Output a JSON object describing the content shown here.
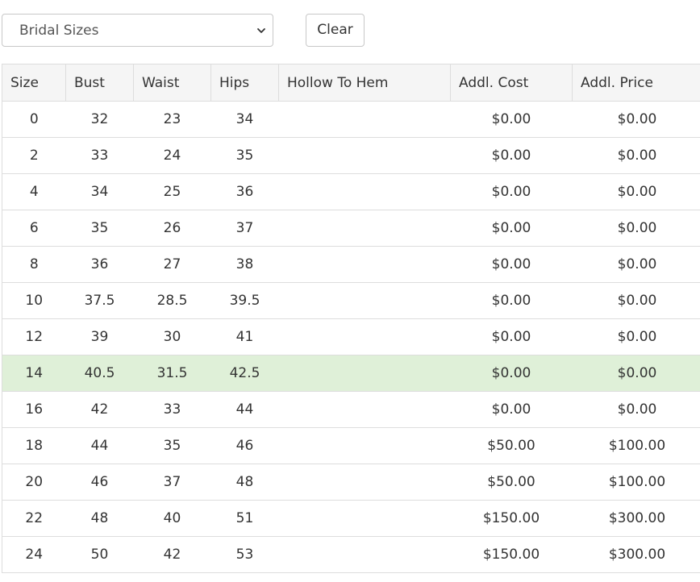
{
  "filter": {
    "selected": "Bridal Sizes",
    "clear_label": "Clear"
  },
  "table": {
    "headers": [
      "Size",
      "Bust",
      "Waist",
      "Hips",
      "Hollow To Hem",
      "Addl. Cost",
      "Addl. Price"
    ],
    "rows": [
      [
        "0",
        "32",
        "23",
        "34",
        "",
        "$0.00",
        "$0.00"
      ],
      [
        "2",
        "33",
        "24",
        "35",
        "",
        "$0.00",
        "$0.00"
      ],
      [
        "4",
        "34",
        "25",
        "36",
        "",
        "$0.00",
        "$0.00"
      ],
      [
        "6",
        "35",
        "26",
        "37",
        "",
        "$0.00",
        "$0.00"
      ],
      [
        "8",
        "36",
        "27",
        "38",
        "",
        "$0.00",
        "$0.00"
      ],
      [
        "10",
        "37.5",
        "28.5",
        "39.5",
        "",
        "$0.00",
        "$0.00"
      ],
      [
        "12",
        "39",
        "30",
        "41",
        "",
        "$0.00",
        "$0.00"
      ],
      [
        "14",
        "40.5",
        "31.5",
        "42.5",
        "",
        "$0.00",
        "$0.00"
      ],
      [
        "16",
        "42",
        "33",
        "44",
        "",
        "$0.00",
        "$0.00"
      ],
      [
        "18",
        "44",
        "35",
        "46",
        "",
        "$50.00",
        "$100.00"
      ],
      [
        "20",
        "46",
        "37",
        "48",
        "",
        "$50.00",
        "$100.00"
      ],
      [
        "22",
        "48",
        "40",
        "51",
        "",
        "$150.00",
        "$300.00"
      ],
      [
        "24",
        "50",
        "42",
        "53",
        "",
        "$150.00",
        "$300.00"
      ]
    ],
    "selected_row_index": 7
  },
  "colors": {
    "selected_row": "#dff0d8",
    "header_bg": "#f5f5f5",
    "border": "#dddddd"
  }
}
